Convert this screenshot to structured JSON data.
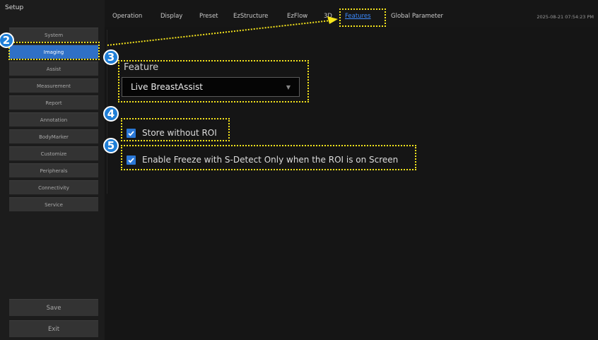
{
  "sidebar": {
    "title": "Setup",
    "items": [
      {
        "label": "System"
      },
      {
        "label": "Imaging"
      },
      {
        "label": "Assist"
      },
      {
        "label": "Measurement"
      },
      {
        "label": "Report"
      },
      {
        "label": "Annotation"
      },
      {
        "label": "BodyMarker"
      },
      {
        "label": "Customize"
      },
      {
        "label": "Peripherals"
      },
      {
        "label": "Connectivity"
      },
      {
        "label": "Service"
      }
    ],
    "save_label": "Save",
    "exit_label": "Exit"
  },
  "topbar": {
    "tabs": [
      {
        "label": "Operation"
      },
      {
        "label": "Display"
      },
      {
        "label": "Preset"
      },
      {
        "label": "EzStructure"
      },
      {
        "label": "EzFlow"
      },
      {
        "label": "3D"
      },
      {
        "label": "Features"
      },
      {
        "label": "Global Parameter"
      }
    ],
    "active_tab": "Features",
    "datetime": "2025-08-21 07:54:23 PM"
  },
  "main": {
    "feature_label": "Feature",
    "feature_value": "Live BreastAssist",
    "checkboxes": [
      {
        "label": "Store without ROI",
        "checked": true
      },
      {
        "label": "Enable Freeze with S-Detect Only when the ROI is on Screen",
        "checked": true
      }
    ]
  },
  "annotations": {
    "badges": [
      "2",
      "3",
      "4",
      "5"
    ],
    "highlight_color": "#f5e41c",
    "badge_color": "#1f7fd8"
  },
  "colors": {
    "accent": "#2f70c6",
    "active_tab": "#3c8bff",
    "checkbox": "#2a78d7"
  }
}
